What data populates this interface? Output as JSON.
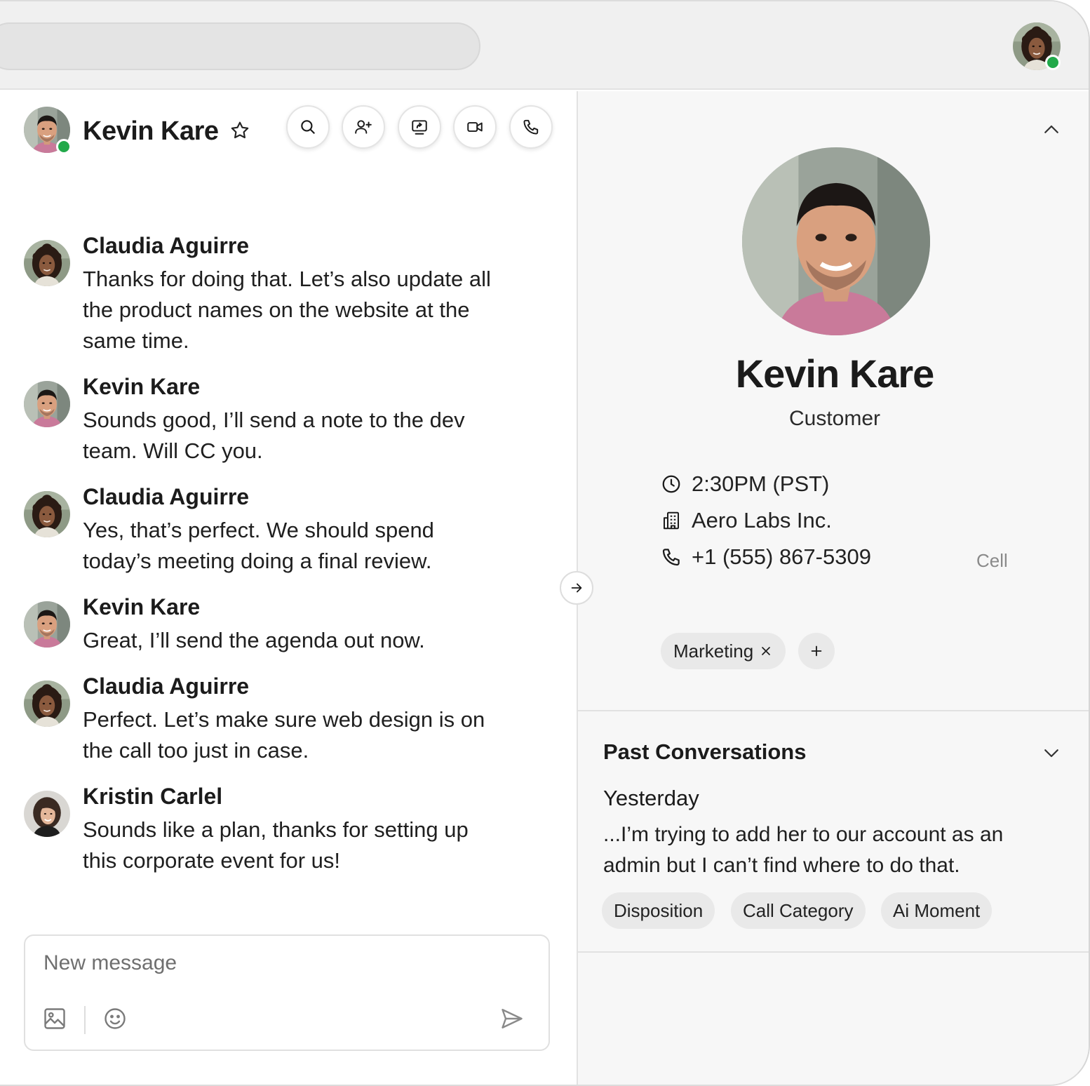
{
  "topbar": {
    "search_placeholder": "",
    "me_avatar": "claudia-avatar",
    "me_status_color": "#22a94a"
  },
  "chat": {
    "contact_name": "Kevin Kare",
    "contact_status_color": "#22a94a",
    "actions": [
      {
        "icon": "search-icon"
      },
      {
        "icon": "add-user-icon"
      },
      {
        "icon": "screen-share-icon"
      },
      {
        "icon": "video-icon"
      },
      {
        "icon": "phone-icon"
      }
    ],
    "messages": [
      {
        "sender": "Claudia Aguirre",
        "text": "Thanks for doing that. Let’s also update all the product names on the website at the same time."
      },
      {
        "sender": "Kevin Kare",
        "text": "Sounds good, I’ll send a note to the dev team. Will CC you."
      },
      {
        "sender": "Claudia Aguirre",
        "text": "Yes, that’s perfect. We should spend today’s meeting doing a final review."
      },
      {
        "sender": "Kevin Kare",
        "text": "Great, I’ll send the agenda out now."
      },
      {
        "sender": "Claudia Aguirre",
        "text": "Perfect. Let’s make sure web design is on the call too just in case."
      },
      {
        "sender": "Kristin Carlel",
        "text": "Sounds like a plan, thanks for setting up this corporate event for us!"
      }
    ],
    "composer": {
      "placeholder": "New message"
    }
  },
  "profile": {
    "name": "Kevin Kare",
    "role": "Customer",
    "time": "2:30PM (PST)",
    "company": "Aero Labs Inc.",
    "phone": "+1 (555) 867-5309",
    "phone_type": "Cell",
    "tags": [
      "Marketing"
    ]
  },
  "past_conversations": {
    "title": "Past Conversations",
    "day": "Yesterday",
    "snippet": "...I’m trying to add her to our account as an admin but I can’t find where to do that.",
    "chips": [
      "Disposition",
      "Call Category",
      "Ai Moment"
    ]
  }
}
